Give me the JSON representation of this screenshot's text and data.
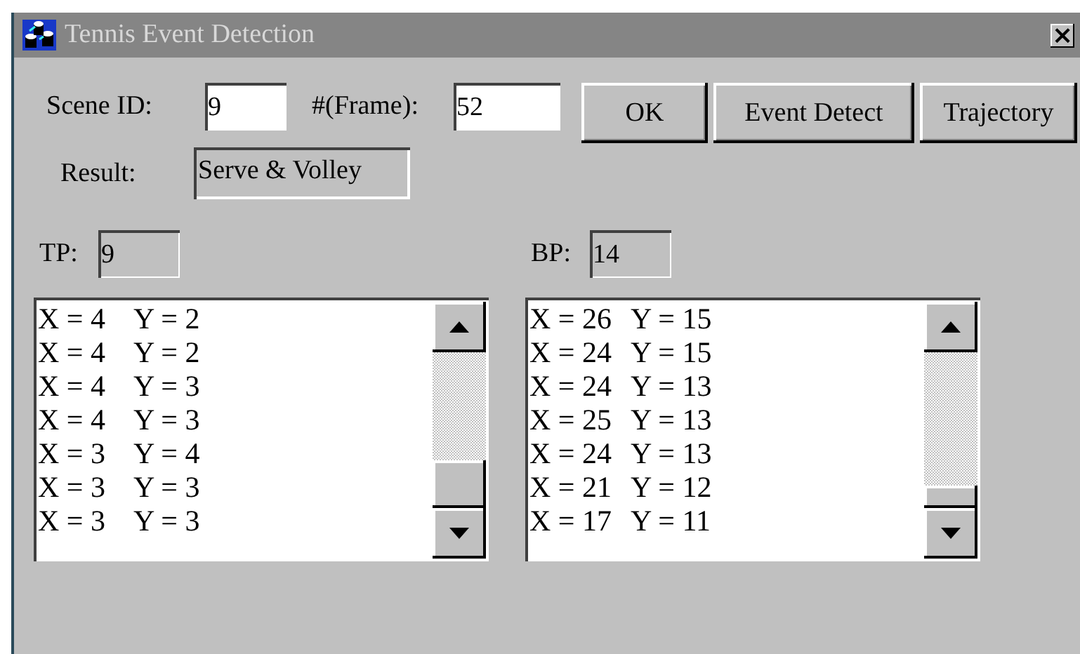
{
  "window": {
    "title": "Tennis Event Detection",
    "close": "×"
  },
  "form": {
    "scene_label": "Scene ID:",
    "scene_value": "9",
    "frame_label": "#(Frame):",
    "frame_value": "52",
    "result_label": "Result:",
    "result_value": "Serve & Volley"
  },
  "buttons": [
    "OK",
    "Event Detect",
    "Trajectory"
  ],
  "panels": [
    {
      "label": "TP:",
      "value": "9",
      "rows": [
        {
          "x": "X = 4",
          "y": "Y = 2"
        },
        {
          "x": "X = 4",
          "y": "Y = 2"
        },
        {
          "x": "X = 4",
          "y": "Y = 3"
        },
        {
          "x": "X = 4",
          "y": "Y = 3"
        },
        {
          "x": "X = 3",
          "y": "Y = 4"
        },
        {
          "x": "X = 3",
          "y": "Y = 3"
        },
        {
          "x": "X = 3",
          "y": "Y = 3"
        }
      ]
    },
    {
      "label": "BP:",
      "value": "14",
      "rows": [
        {
          "x": "X = 26",
          "y": "Y = 15"
        },
        {
          "x": "X = 24",
          "y": "Y = 15"
        },
        {
          "x": "X = 24",
          "y": "Y = 13"
        },
        {
          "x": "X = 25",
          "y": "Y = 13"
        },
        {
          "x": "X = 24",
          "y": "Y = 13"
        },
        {
          "x": "X = 21",
          "y": "Y = 12"
        },
        {
          "x": "X = 17",
          "y": "Y = 11"
        }
      ]
    }
  ]
}
